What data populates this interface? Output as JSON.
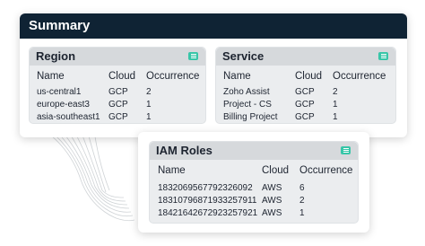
{
  "summary": {
    "title": "Summary"
  },
  "region": {
    "title": "Region",
    "icon": "list-icon",
    "columns": [
      "Name",
      "Cloud",
      "Occurrence"
    ],
    "rows": [
      [
        "us-central1",
        "GCP",
        "2"
      ],
      [
        "europe-east3",
        "GCP",
        "1"
      ],
      [
        "asia-southeast1",
        "GCP",
        "1"
      ]
    ]
  },
  "service": {
    "title": "Service",
    "icon": "list-icon",
    "columns": [
      "Name",
      "Cloud",
      "Occurrence"
    ],
    "rows": [
      [
        "Zoho Assist",
        "GCP",
        "2"
      ],
      [
        "Project - CS",
        "GCP",
        "1"
      ],
      [
        "Billing Project",
        "GCP",
        "1"
      ]
    ]
  },
  "iam": {
    "title": "IAM Roles",
    "icon": "list-icon",
    "columns": [
      "Name",
      "Cloud",
      "Occurrence"
    ],
    "rows": [
      [
        "18320695677923260​92",
        "AWS",
        "6"
      ],
      [
        "1831079687193325791​1",
        "AWS",
        "2"
      ],
      [
        "1842164267292325792​1",
        "AWS",
        "1"
      ]
    ]
  },
  "colors": {
    "header_bg": "#0f2334",
    "card_bg": "#ebedef",
    "card_title_bg": "#d6d9dc",
    "icon_accent": "#37c6a8"
  }
}
